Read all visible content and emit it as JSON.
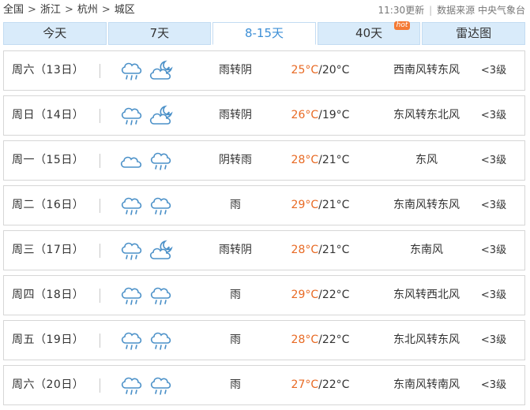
{
  "breadcrumb": {
    "items": [
      "全国",
      "浙江",
      "杭州",
      "城区"
    ],
    "separator": ">"
  },
  "meta": {
    "update_time": "11:30更新",
    "source": "数据来源 中央气象台"
  },
  "tabs": [
    {
      "label": "今天",
      "active": false,
      "hot": ""
    },
    {
      "label": "7天",
      "active": false,
      "hot": ""
    },
    {
      "label": "8-15天",
      "active": true,
      "hot": ""
    },
    {
      "label": "40天",
      "active": false,
      "hot": "hot"
    },
    {
      "label": "雷达图",
      "active": false,
      "hot": ""
    }
  ],
  "colors": {
    "tab_bg": "#d9ebfa",
    "tab_active_text": "#3d8fd6",
    "high_temp": "#e86a24",
    "hot_badge": "#f47a34",
    "icon_stroke": "#4a90c8"
  },
  "days": [
    {
      "date": "周六（13日）",
      "icons": [
        "rain-cloud-icon",
        "moon-cloud-icon"
      ],
      "condition": "雨转阴",
      "high": "25°C",
      "low": "20°C",
      "wind": "西南风转东风",
      "level": "<3级"
    },
    {
      "date": "周日（14日）",
      "icons": [
        "rain-cloud-icon",
        "moon-cloud-icon"
      ],
      "condition": "雨转阴",
      "high": "26°C",
      "low": "19°C",
      "wind": "东风转东北风",
      "level": "<3级"
    },
    {
      "date": "周一（15日）",
      "icons": [
        "cloud-icon",
        "rain-cloud-icon"
      ],
      "condition": "阴转雨",
      "high": "28°C",
      "low": "21°C",
      "wind": "东风",
      "level": "<3级"
    },
    {
      "date": "周二（16日）",
      "icons": [
        "rain-cloud-icon",
        "rain-cloud-icon"
      ],
      "condition": "雨",
      "high": "29°C",
      "low": "21°C",
      "wind": "东南风转东风",
      "level": "<3级"
    },
    {
      "date": "周三（17日）",
      "icons": [
        "rain-cloud-icon",
        "moon-cloud-icon"
      ],
      "condition": "雨转阴",
      "high": "28°C",
      "low": "21°C",
      "wind": "东南风",
      "level": "<3级"
    },
    {
      "date": "周四（18日）",
      "icons": [
        "rain-cloud-icon",
        "rain-cloud-icon"
      ],
      "condition": "雨",
      "high": "29°C",
      "low": "22°C",
      "wind": "东风转西北风",
      "level": "<3级"
    },
    {
      "date": "周五（19日）",
      "icons": [
        "rain-cloud-icon",
        "rain-cloud-icon"
      ],
      "condition": "雨",
      "high": "28°C",
      "low": "22°C",
      "wind": "东北风转东风",
      "level": "<3级"
    },
    {
      "date": "周六（20日）",
      "icons": [
        "rain-cloud-icon",
        "rain-cloud-icon"
      ],
      "condition": "雨",
      "high": "27°C",
      "low": "22°C",
      "wind": "东南风转南风",
      "level": "<3级"
    }
  ]
}
